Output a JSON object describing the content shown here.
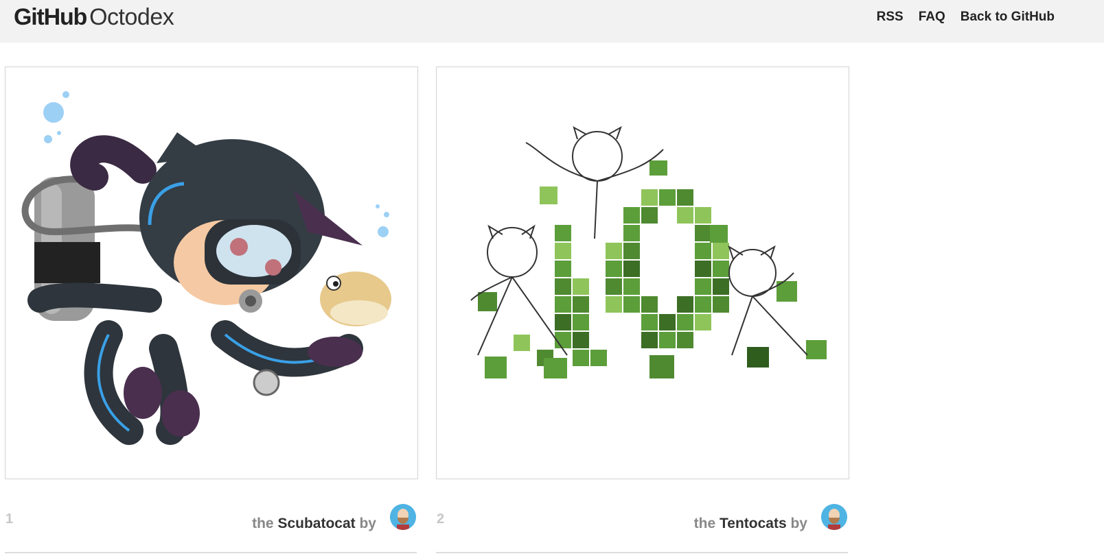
{
  "header": {
    "logo_brand": "GitHub",
    "logo_product": "Octodex",
    "nav": [
      "RSS",
      "FAQ",
      "Back to GitHub"
    ]
  },
  "cards": [
    {
      "number": "1",
      "prefix": "the",
      "name": "Scubatocat",
      "suffix": "by",
      "image_icon": "scubatocat-illustration"
    },
    {
      "number": "2",
      "prefix": "the",
      "name": "Tentocats",
      "suffix": "by",
      "image_icon": "tentocats-illustration"
    }
  ],
  "colors": {
    "header_bg": "#f2f2f2",
    "accent_blue": "#3aa0e6",
    "green": "#5c9e3a"
  }
}
